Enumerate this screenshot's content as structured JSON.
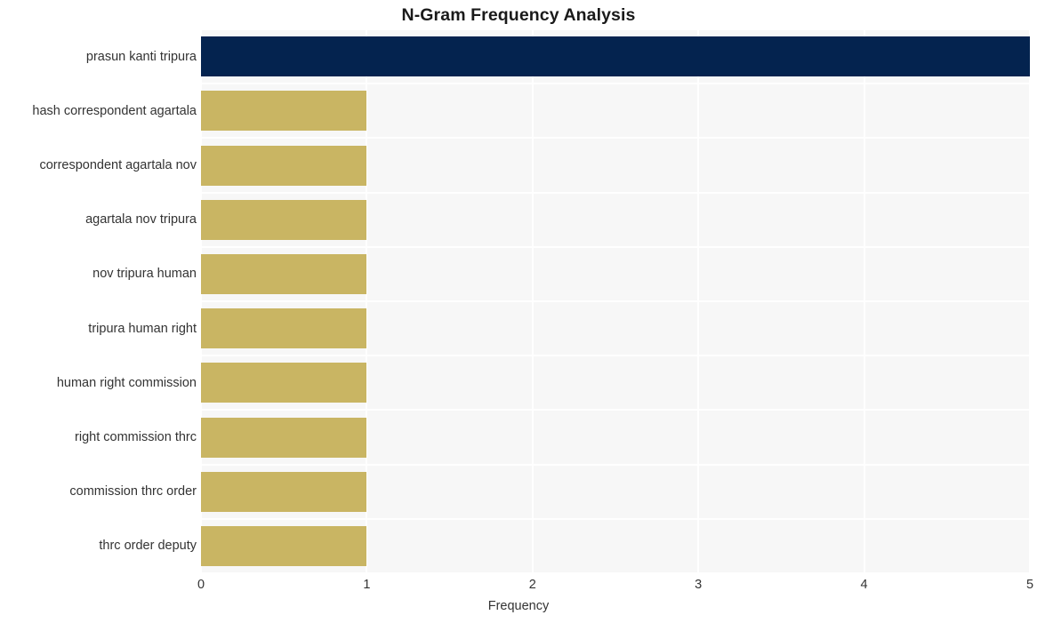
{
  "chart_data": {
    "type": "bar",
    "orientation": "horizontal",
    "title": "N-Gram Frequency Analysis",
    "xlabel": "Frequency",
    "ylabel": "",
    "categories": [
      "prasun kanti tripura",
      "hash correspondent agartala",
      "correspondent agartala nov",
      "agartala nov tripura",
      "nov tripura human",
      "tripura human right",
      "human right commission",
      "right commission thrc",
      "commission thrc order",
      "thrc order deputy"
    ],
    "values": [
      5,
      1,
      1,
      1,
      1,
      1,
      1,
      1,
      1,
      1
    ],
    "bar_colors": [
      "#04234f",
      "#c9b563",
      "#c9b563",
      "#c9b563",
      "#c9b563",
      "#c9b563",
      "#c9b563",
      "#c9b563",
      "#c9b563",
      "#c9b563"
    ],
    "xlim": [
      0,
      5
    ],
    "xticks": [
      "0",
      "1",
      "2",
      "3",
      "4",
      "5"
    ],
    "xtick_values": [
      0,
      1,
      2,
      3,
      4,
      5
    ],
    "grid": true,
    "grid_color": "#ffffff",
    "plot_background": "#f7f7f7",
    "figure_background": "#ffffff",
    "legend": null
  }
}
